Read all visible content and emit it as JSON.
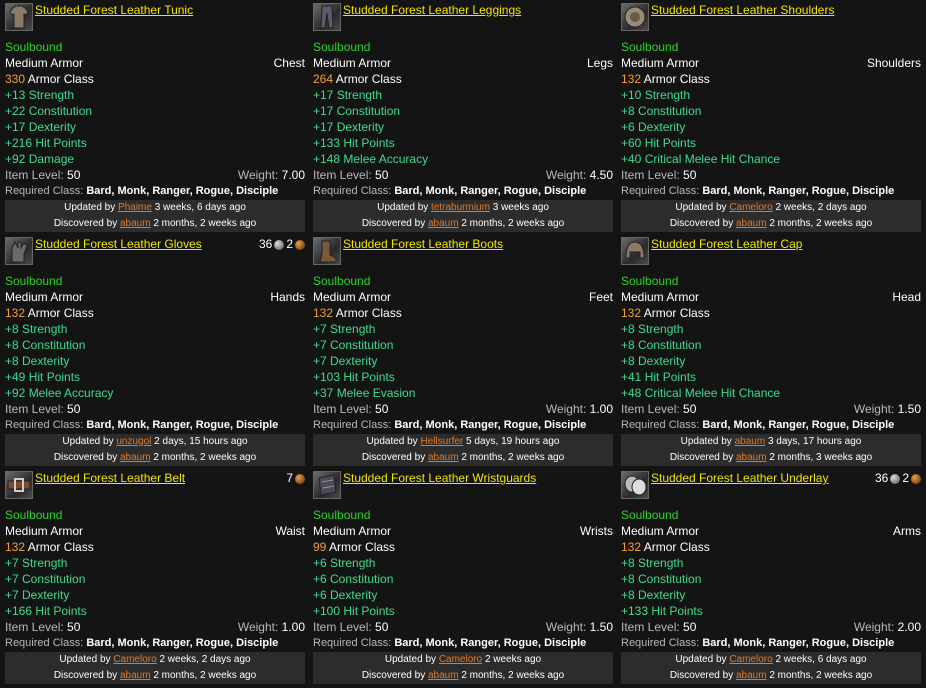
{
  "items": [
    {
      "name": "Studded Forest Leather Tunic",
      "icon": "tunic-icon",
      "price": null,
      "soulbound": "Soulbound",
      "armor_type": "Medium Armor",
      "slot": "Chest",
      "armor_value": "330",
      "armor_label": "Armor Class",
      "stats": [
        "+13 Strength",
        "+22 Constitution",
        "+17 Dexterity",
        "+216 Hit Points",
        "+92 Damage"
      ],
      "item_level_label": "Item Level:",
      "item_level": "50",
      "weight_label": "Weight:",
      "weight": "7.00",
      "req_label": "Required Class:",
      "req_classes": "Bard, Monk, Ranger, Rogue, Disciple",
      "updated_prefix": "Updated by",
      "updated_by": "Phaime",
      "updated_ago": "3 weeks, 6 days ago",
      "discovered_prefix": "Discovered by",
      "discovered_by": "abaum",
      "discovered_ago": "2 months, 2 weeks ago"
    },
    {
      "name": "Studded Forest Leather Leggings",
      "icon": "leggings-icon",
      "price": null,
      "soulbound": "Soulbound",
      "armor_type": "Medium Armor",
      "slot": "Legs",
      "armor_value": "264",
      "armor_label": "Armor Class",
      "stats": [
        "+17 Strength",
        "+17 Constitution",
        "+17 Dexterity",
        "+133 Hit Points",
        "+148 Melee Accuracy"
      ],
      "item_level_label": "Item Level:",
      "item_level": "50",
      "weight_label": "Weight:",
      "weight": "4.50",
      "req_label": "Required Class:",
      "req_classes": "Bard, Monk, Ranger, Rogue, Disciple",
      "updated_prefix": "Updated by",
      "updated_by": "tetraburmium",
      "updated_ago": "3 weeks ago",
      "discovered_prefix": "Discovered by",
      "discovered_by": "abaum",
      "discovered_ago": "2 months, 2 weeks ago"
    },
    {
      "name": "Studded Forest Leather Shoulders",
      "icon": "shoulders-icon",
      "price": null,
      "soulbound": "Soulbound",
      "armor_type": "Medium Armor",
      "slot": "Shoulders",
      "armor_value": "132",
      "armor_label": "Armor Class",
      "stats": [
        "+10 Strength",
        "+8 Constitution",
        "+6 Dexterity",
        "+60 Hit Points",
        "+40 Critical Melee Hit Chance"
      ],
      "item_level_label": "Item Level:",
      "item_level": "50",
      "weight_label": "",
      "weight": "",
      "req_label": "Required Class:",
      "req_classes": "Bard, Monk, Ranger, Rogue, Disciple",
      "updated_prefix": "Updated by",
      "updated_by": "Cameloro",
      "updated_ago": "2 weeks, 2 days ago",
      "discovered_prefix": "Discovered by",
      "discovered_by": "abaum",
      "discovered_ago": "2 months, 2 weeks ago"
    },
    {
      "name": "Studded Forest Leather Gloves",
      "icon": "gloves-icon",
      "price": {
        "silver": "36",
        "copper": "2"
      },
      "soulbound": "Soulbound",
      "armor_type": "Medium Armor",
      "slot": "Hands",
      "armor_value": "132",
      "armor_label": "Armor Class",
      "stats": [
        "+8 Strength",
        "+8 Constitution",
        "+8 Dexterity",
        "+49 Hit Points",
        "+92 Melee Accuracy"
      ],
      "item_level_label": "Item Level:",
      "item_level": "50",
      "weight_label": "",
      "weight": "",
      "req_label": "Required Class:",
      "req_classes": "Bard, Monk, Ranger, Rogue, Disciple",
      "updated_prefix": "Updated by",
      "updated_by": "unzugol",
      "updated_ago": "2 days, 15 hours ago",
      "discovered_prefix": "Discovered by",
      "discovered_by": "abaum",
      "discovered_ago": "2 months, 2 weeks ago"
    },
    {
      "name": "Studded Forest Leather Boots",
      "icon": "boots-icon",
      "price": null,
      "soulbound": "Soulbound",
      "armor_type": "Medium Armor",
      "slot": "Feet",
      "armor_value": "132",
      "armor_label": "Armor Class",
      "stats": [
        "+7 Strength",
        "+7 Constitution",
        "+7 Dexterity",
        "+103 Hit Points",
        "+37 Melee Evasion"
      ],
      "item_level_label": "Item Level:",
      "item_level": "50",
      "weight_label": "Weight:",
      "weight": "1.00",
      "req_label": "Required Class:",
      "req_classes": "Bard, Monk, Ranger, Rogue, Disciple",
      "updated_prefix": "Updated by",
      "updated_by": "Hellsurfer",
      "updated_ago": "5 days, 19 hours ago",
      "discovered_prefix": "Discovered by",
      "discovered_by": "abaum",
      "discovered_ago": "2 months, 2 weeks ago"
    },
    {
      "name": "Studded Forest Leather Cap",
      "icon": "cap-icon",
      "price": null,
      "soulbound": "Soulbound",
      "armor_type": "Medium Armor",
      "slot": "Head",
      "armor_value": "132",
      "armor_label": "Armor Class",
      "stats": [
        "+8 Strength",
        "+8 Constitution",
        "+8 Dexterity",
        "+41 Hit Points",
        "+48 Critical Melee Hit Chance"
      ],
      "item_level_label": "Item Level:",
      "item_level": "50",
      "weight_label": "Weight:",
      "weight": "1.50",
      "req_label": "Required Class:",
      "req_classes": "Bard, Monk, Ranger, Rogue, Disciple",
      "updated_prefix": "Updated by",
      "updated_by": "abaum",
      "updated_ago": "3 days, 17 hours ago",
      "discovered_prefix": "Discovered by",
      "discovered_by": "abaum",
      "discovered_ago": "2 months, 3 weeks ago"
    },
    {
      "name": "Studded Forest Leather Belt",
      "icon": "belt-icon",
      "price": {
        "silver": null,
        "copper": "7"
      },
      "soulbound": "Soulbound",
      "armor_type": "Medium Armor",
      "slot": "Waist",
      "armor_value": "132",
      "armor_label": "Armor Class",
      "stats": [
        "+7 Strength",
        "+7 Constitution",
        "+7 Dexterity",
        "+166 Hit Points"
      ],
      "item_level_label": "Item Level:",
      "item_level": "50",
      "weight_label": "Weight:",
      "weight": "1.00",
      "req_label": "Required Class:",
      "req_classes": "Bard, Monk, Ranger, Rogue, Disciple",
      "updated_prefix": "Updated by",
      "updated_by": "Cameloro",
      "updated_ago": "2 weeks, 2 days ago",
      "discovered_prefix": "Discovered by",
      "discovered_by": "abaum",
      "discovered_ago": "2 months, 2 weeks ago"
    },
    {
      "name": "Studded Forest Leather Wristguards",
      "icon": "wristguards-icon",
      "price": null,
      "soulbound": "Soulbound",
      "armor_type": "Medium Armor",
      "slot": "Wrists",
      "armor_value": "99",
      "armor_label": "Armor Class",
      "stats": [
        "+6 Strength",
        "+6 Constitution",
        "+6 Dexterity",
        "+100 Hit Points"
      ],
      "item_level_label": "Item Level:",
      "item_level": "50",
      "weight_label": "Weight:",
      "weight": "1.50",
      "req_label": "Required Class:",
      "req_classes": "Bard, Monk, Ranger, Rogue, Disciple",
      "updated_prefix": "Updated by",
      "updated_by": "Cameloro",
      "updated_ago": "2 weeks ago",
      "discovered_prefix": "Discovered by",
      "discovered_by": "abaum",
      "discovered_ago": "2 months, 2 weeks ago"
    },
    {
      "name": "Studded Forest Leather Underlay",
      "icon": "underlay-icon",
      "price": {
        "silver": "36",
        "copper": "2"
      },
      "soulbound": "Soulbound",
      "armor_type": "Medium Armor",
      "slot": "Arms",
      "armor_value": "132",
      "armor_label": "Armor Class",
      "stats": [
        "+8 Strength",
        "+8 Constitution",
        "+8 Dexterity",
        "+133 Hit Points"
      ],
      "item_level_label": "Item Level:",
      "item_level": "50",
      "weight_label": "Weight:",
      "weight": "2.00",
      "req_label": "Required Class:",
      "req_classes": "Bard, Monk, Ranger, Rogue, Disciple",
      "updated_prefix": "Updated by",
      "updated_by": "Cameloro",
      "updated_ago": "2 weeks, 6 days ago",
      "discovered_prefix": "Discovered by",
      "discovered_by": "abaum",
      "discovered_ago": "2 months, 2 weeks ago"
    }
  ],
  "colors": {
    "name": "#f2e600",
    "soulbound": "#2bd62b",
    "armor_value": "#f0a030",
    "stat": "#3fdc8e",
    "user_link": "#e07a2a",
    "meta_bg": "#2c2c2c"
  }
}
